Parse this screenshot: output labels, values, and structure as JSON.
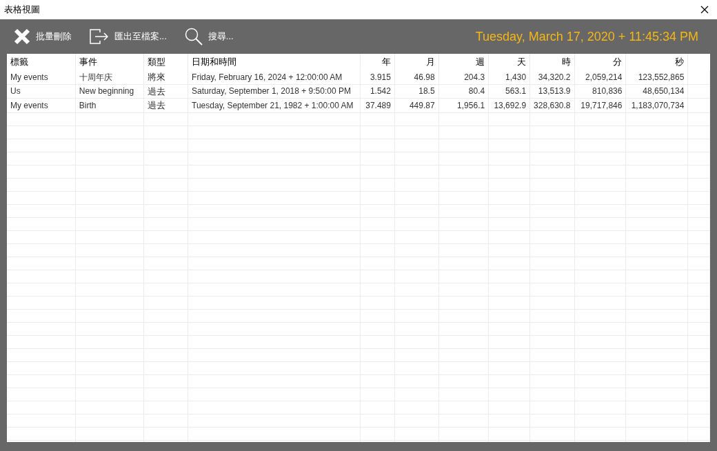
{
  "window": {
    "title": "表格視圖"
  },
  "toolbar": [
    {
      "kind": "delete",
      "label": "批量刪除"
    },
    {
      "kind": "export",
      "label": "匯出至檔案..."
    },
    {
      "kind": "search",
      "label": "搜尋..."
    }
  ],
  "current_datetime": "Tuesday, March 17, 2020 + 11:45:34 PM",
  "table": {
    "columns": [
      "標籤",
      "事件",
      "類型",
      "日期和時間",
      "年",
      "月",
      "週",
      "天",
      "時",
      "分",
      "秒"
    ],
    "rows": [
      [
        "My events",
        "十周年庆",
        "將來",
        "Friday, February 16, 2024 + 12:00:00 AM",
        "3.915",
        "46.98",
        "204.3",
        "1,430",
        "34,320.2",
        "2,059,214",
        "123,552,865"
      ],
      [
        "Us",
        "New beginning",
        "過去",
        "Saturday, September 1, 2018 + 9:50:00 PM",
        "1.542",
        "18.5",
        "80.4",
        "563.1",
        "13,513.9",
        "810,836",
        "48,650,134"
      ],
      [
        "My events",
        "Birth",
        "過去",
        "Tuesday, September 21, 1982 + 1:00:00 AM",
        "37.489",
        "449.87",
        "1,956.1",
        "13,692.9",
        "328,630.8",
        "19,717,846",
        "1,183,070,734"
      ]
    ]
  }
}
